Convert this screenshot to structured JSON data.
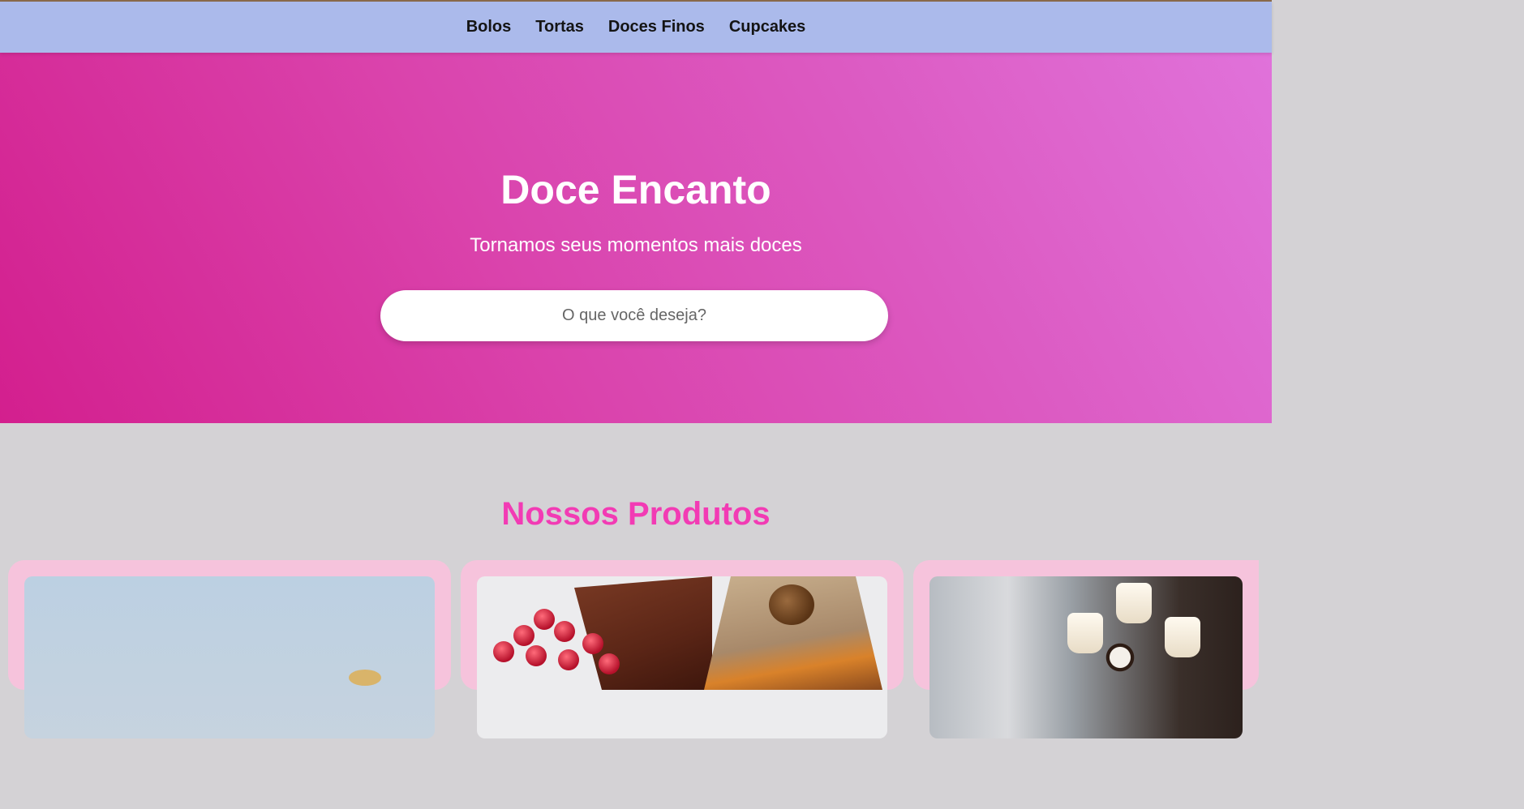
{
  "nav": {
    "links": [
      "Bolos",
      "Tortas",
      "Doces Finos",
      "Cupcakes"
    ]
  },
  "hero": {
    "title": "Doce Encanto",
    "subtitle": "Tornamos seus momentos mais doces",
    "search_placeholder": "O que você deseja?"
  },
  "products": {
    "title": "Nossos Produtos",
    "cards": [
      {
        "image": "product-photo"
      },
      {
        "image": "cakes-with-raspberries-photo"
      },
      {
        "image": "fine-sweets-photo"
      }
    ]
  },
  "colors": {
    "nav_bg": "#abbaeb",
    "hero_gradient_start": "#d31f8e",
    "hero_gradient_end": "#e072da",
    "section_title": "#f23bb4",
    "card_bg": "#f6c3dc",
    "page_bg": "#d4d2d5"
  }
}
